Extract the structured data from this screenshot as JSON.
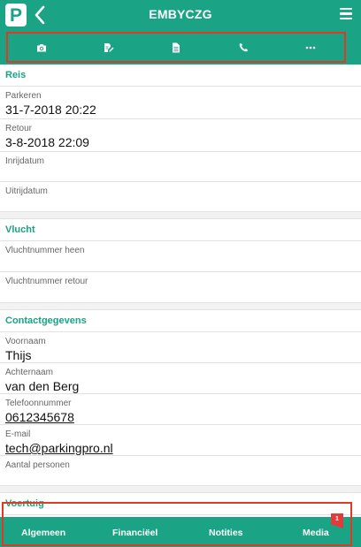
{
  "header": {
    "title": "EMBYCZG",
    "logo_letter": "P",
    "back_glyph": "‹"
  },
  "toolbar": {
    "actions": [
      {
        "icon": "camera-icon"
      },
      {
        "icon": "edit-document-icon"
      },
      {
        "icon": "document-icon"
      },
      {
        "icon": "phone-icon"
      },
      {
        "icon": "more-icon"
      }
    ]
  },
  "sections": {
    "reis": {
      "title": "Reis",
      "fields": [
        {
          "label": "Parkeren",
          "value": "31-7-2018 20:22"
        },
        {
          "label": "Retour",
          "value": "3-8-2018 22:09"
        },
        {
          "label": "Inrijdatum",
          "value": ""
        },
        {
          "label": "Uitrijdatum",
          "value": ""
        }
      ]
    },
    "vlucht": {
      "title": "Vlucht",
      "fields": [
        {
          "label": "Vluchtnummer heen",
          "value": ""
        },
        {
          "label": "Vluchtnummer retour",
          "value": ""
        }
      ]
    },
    "contact": {
      "title": "Contactgegevens",
      "fields": [
        {
          "label": "Voornaam",
          "value": "Thijs"
        },
        {
          "label": "Achternaam",
          "value": "van den Berg"
        },
        {
          "label": "Telefoonnummer",
          "value": "0612345678"
        },
        {
          "label": "E-mail",
          "value": "tech@parkingpro.nl"
        },
        {
          "label": "Aantal personen",
          "value": ""
        }
      ]
    },
    "voertuig": {
      "title": "Voertuig"
    }
  },
  "bottom_tabs": {
    "algemeen": "Algemeen",
    "financieel": "Financiëel",
    "notities": "Notities",
    "media": "Media",
    "media_badge": "1"
  },
  "colors": {
    "brand": "#1aa384",
    "highlight_frame": "#e03a25",
    "badge": "#e23b3b"
  }
}
